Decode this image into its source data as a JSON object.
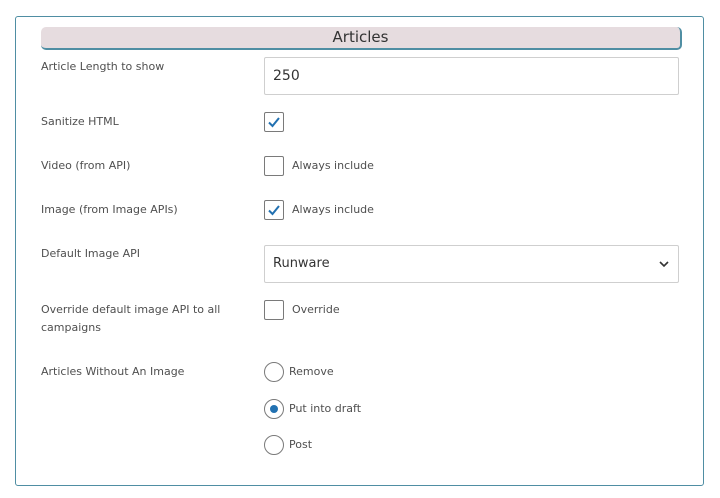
{
  "section": {
    "title": "Articles"
  },
  "fields": {
    "article_length": {
      "label": "Article Length to show",
      "value": "250"
    },
    "sanitize_html": {
      "label": "Sanitize HTML",
      "checked": true
    },
    "video": {
      "label": "Video (from API)",
      "option_label": "Always include",
      "checked": false
    },
    "image": {
      "label": "Image (from Image APIs)",
      "option_label": "Always include",
      "checked": true
    },
    "default_image_api": {
      "label": "Default Image API",
      "selected": "Runware"
    },
    "override_image_api": {
      "label": "Override default image API to all campaigns",
      "option_label": "Override",
      "checked": false
    },
    "articles_without_image": {
      "label": "Articles Without An Image",
      "options": [
        {
          "label": "Remove",
          "selected": false
        },
        {
          "label": "Put into draft",
          "selected": true
        },
        {
          "label": "Post",
          "selected": false
        }
      ]
    }
  },
  "colors": {
    "accent": "#2271b1",
    "border": "#4f8ea3",
    "header_bg": "#e6dcdf"
  }
}
